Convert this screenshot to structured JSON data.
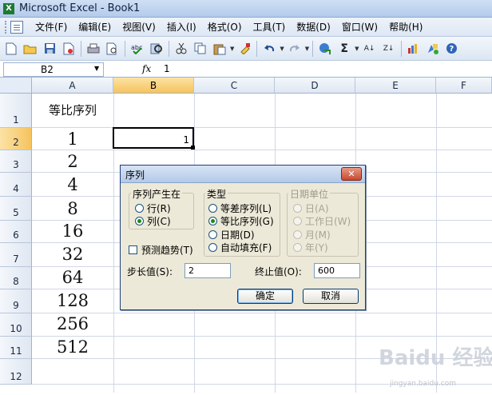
{
  "window": {
    "title": "Microsoft Excel - Book1"
  },
  "menu": [
    "文件(F)",
    "编辑(E)",
    "视图(V)",
    "插入(I)",
    "格式(O)",
    "工具(T)",
    "数据(D)",
    "窗口(W)",
    "帮助(H)"
  ],
  "toolbar": {
    "sigma": "Σ",
    "sort_asc": "A↓",
    "sort_desc": "Z↓"
  },
  "formula_bar": {
    "name_box": "B2",
    "fx": "fx",
    "content": "1"
  },
  "grid": {
    "columns": [
      "A",
      "B",
      "C",
      "D",
      "E",
      "F"
    ],
    "selected_column": "B",
    "rows": [
      "1",
      "2",
      "3",
      "4",
      "5",
      "6",
      "7",
      "8",
      "9",
      "10",
      "11",
      "12"
    ],
    "selected_row": "2",
    "col_a_header_text": "等比序列",
    "col_a_values": [
      "1",
      "2",
      "4",
      "8",
      "16",
      "32",
      "64",
      "128",
      "256",
      "512"
    ],
    "active_cell_value": "1"
  },
  "dialog": {
    "title": "序列",
    "close": "✕",
    "series_in": {
      "title": "序列产生在",
      "options": [
        "行(R)",
        "列(C)"
      ],
      "selected": "列(C)"
    },
    "trend": {
      "label": "预测趋势(T)",
      "checked": false
    },
    "type": {
      "title": "类型",
      "options": [
        "等差序列(L)",
        "等比序列(G)",
        "日期(D)",
        "自动填充(F)"
      ],
      "selected": "等比序列(G)"
    },
    "date_unit": {
      "title": "日期单位",
      "options": [
        "日(A)",
        "工作日(W)",
        "月(M)",
        "年(Y)"
      ],
      "selected": "日(A)",
      "disabled": true
    },
    "step": {
      "label": "步长值(S):",
      "value": "2"
    },
    "stop": {
      "label": "终止值(O):",
      "value": "600"
    },
    "ok_button": "确定",
    "cancel_button": "取消"
  },
  "watermark": {
    "text": "Baidu 经验",
    "subtext": "jingyan.baidu.com"
  },
  "colors": {
    "accent": "#f6c35e",
    "title_bar": "#b3cbea",
    "dialog_bg": "#ece9d8"
  }
}
